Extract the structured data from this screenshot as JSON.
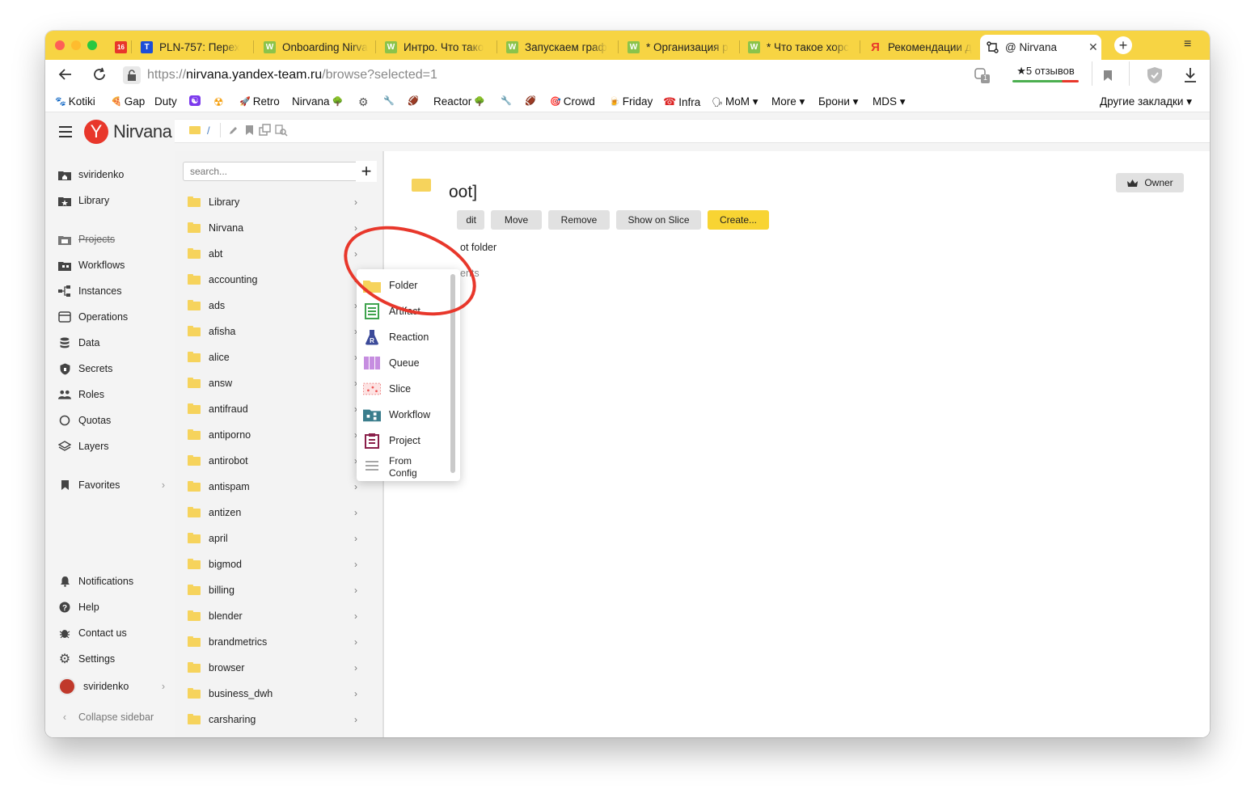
{
  "browser": {
    "tabs": [
      {
        "label": "16",
        "title": ""
      },
      {
        "label": "T",
        "title": "PLN-757: Перех"
      },
      {
        "label": "W",
        "title": "Onboarding Nirva"
      },
      {
        "label": "W",
        "title": "Интро. Что тако"
      },
      {
        "label": "W",
        "title": "Запускаем граф"
      },
      {
        "label": "W",
        "title": "* Организация р"
      },
      {
        "label": "W",
        "title": "* Что такое хорс"
      },
      {
        "label": "Я",
        "title": "Рекомендации д"
      },
      {
        "label": "@",
        "title": "@ Nirvana"
      }
    ],
    "new_tab": "+",
    "menu": "≡",
    "url_scheme": "https://",
    "url_host": "nirvana.yandex-team.ru",
    "url_path": "/browse?selected=1",
    "reviews": "5 отзывов",
    "downloads_count": "1",
    "bookmarks": [
      {
        "label": "Kotiki",
        "icon": "🐾"
      },
      {
        "label": "Gap",
        "icon": "🍕"
      },
      {
        "label": "Duty",
        "icon": ""
      },
      {
        "label": "",
        "icon": "☯"
      },
      {
        "label": "",
        "icon": "☢"
      },
      {
        "label": "Retro",
        "icon": "🚀"
      },
      {
        "label": "Nirvana",
        "icon": "🌳",
        "icon_after": true
      },
      {
        "label": "",
        "icon": "⚙"
      },
      {
        "label": "",
        "icon": "🔧"
      },
      {
        "label": "",
        "icon": "🏈"
      },
      {
        "label": "Reactor",
        "icon": "🌳",
        "icon_after": true
      },
      {
        "label": "",
        "icon": "🔧"
      },
      {
        "label": "",
        "icon": "🏈"
      },
      {
        "label": "Crowd",
        "icon": "🎯"
      },
      {
        "label": "Friday",
        "icon": "🍺"
      },
      {
        "label": "Infra",
        "icon": "☎"
      },
      {
        "label": "MoM ▾",
        "icon": "🗣"
      },
      {
        "label": "More ▾",
        "icon": ""
      },
      {
        "label": "Брони ▾",
        "icon": ""
      },
      {
        "label": "MDS ▾",
        "icon": ""
      }
    ],
    "other_bookmarks": "Другие закладки ▾"
  },
  "app": {
    "logo_letter": "Y",
    "logo_text": "Nirvana",
    "breadcrumb_sep": "/",
    "nav": {
      "user": "sviridenko",
      "library": "Library",
      "projects": "Projects",
      "workflows": "Workflows",
      "instances": "Instances",
      "operations": "Operations",
      "data": "Data",
      "secrets": "Secrets",
      "roles": "Roles",
      "quotas": "Quotas",
      "layers": "Layers",
      "favorites": "Favorites",
      "notifications": "Notifications",
      "help": "Help",
      "contact": "Contact us",
      "settings": "Settings",
      "profile": "sviridenko",
      "collapse": "Collapse sidebar"
    },
    "search_placeholder": "search...",
    "add_button": "+",
    "folders": [
      "Library",
      "Nirvana",
      "abt",
      "accounting",
      "ads",
      "afisha",
      "alice",
      "answ",
      "antifraud",
      "antiporno",
      "antirobot",
      "antispam",
      "antizen",
      "april",
      "bigmod",
      "billing",
      "blender",
      "brandmetrics",
      "browser",
      "business_dwh",
      "carsharing"
    ],
    "content": {
      "title_fragment": "oot]",
      "owner_button": "Owner",
      "edit_fragment": "dit",
      "move": "Move",
      "remove": "Remove",
      "show_on_slice": "Show on Slice",
      "create": "Create...",
      "desc_fragment": "ot folder",
      "ents_fragment": "ents"
    },
    "create_menu": [
      {
        "label": "Folder",
        "icon": "folder-icon"
      },
      {
        "label": "Artifact",
        "icon": "artifact-icon"
      },
      {
        "label": "Reaction",
        "icon": "reaction-icon"
      },
      {
        "label": "Queue",
        "icon": "queue-icon"
      },
      {
        "label": "Slice",
        "icon": "slice-icon"
      },
      {
        "label": "Workflow",
        "icon": "workflow-icon"
      },
      {
        "label": "Project",
        "icon": "project-icon"
      },
      {
        "label": "From",
        "label2": "Config",
        "icon": "lines-icon"
      }
    ]
  },
  "colors": {
    "brand_yellow": "#f7d443",
    "annotation_red": "#e8372b",
    "logo_red": "#e8372b"
  }
}
